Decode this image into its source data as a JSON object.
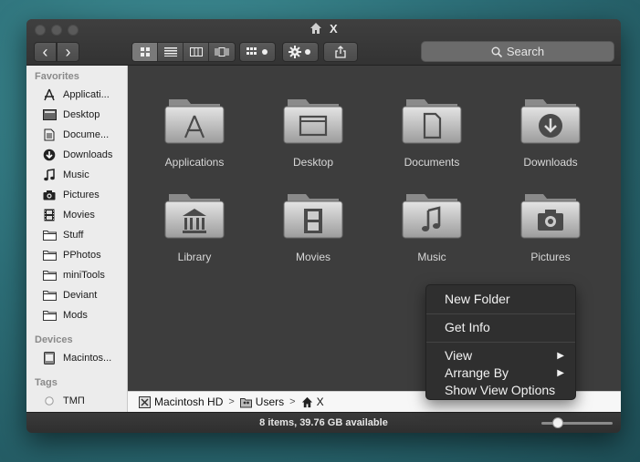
{
  "window": {
    "title": "X"
  },
  "toolbar": {
    "back_label": "‹",
    "forward_label": "›",
    "search_placeholder": "Search"
  },
  "sidebar": {
    "favorites_header": "Favorites",
    "favorites": [
      {
        "label": "Applicati...",
        "icon": "applications-icon"
      },
      {
        "label": "Desktop",
        "icon": "desktop-icon"
      },
      {
        "label": "Docume...",
        "icon": "documents-icon"
      },
      {
        "label": "Downloads",
        "icon": "downloads-icon"
      },
      {
        "label": "Music",
        "icon": "music-icon"
      },
      {
        "label": "Pictures",
        "icon": "camera-icon"
      },
      {
        "label": "Movies",
        "icon": "film-icon"
      },
      {
        "label": "Stuff",
        "icon": "folder-icon"
      },
      {
        "label": "PPhotos",
        "icon": "folder-icon"
      },
      {
        "label": "miniTools",
        "icon": "folder-icon"
      },
      {
        "label": "Deviant",
        "icon": "folder-icon"
      },
      {
        "label": "Mods",
        "icon": "folder-icon"
      }
    ],
    "devices_header": "Devices",
    "devices": [
      {
        "label": "Macintos...",
        "icon": "hard-drive-icon"
      }
    ],
    "tags_header": "Tags",
    "tags": [
      {
        "label": "ТМП",
        "icon": "tag-dot-icon"
      }
    ]
  },
  "content": {
    "items": [
      {
        "label": "Applications",
        "icon": "applications-folder-icon"
      },
      {
        "label": "Desktop",
        "icon": "desktop-folder-icon"
      },
      {
        "label": "Documents",
        "icon": "documents-folder-icon"
      },
      {
        "label": "Downloads",
        "icon": "downloads-folder-icon"
      },
      {
        "label": "Library",
        "icon": "library-folder-icon"
      },
      {
        "label": "Movies",
        "icon": "movies-folder-icon"
      },
      {
        "label": "Music",
        "icon": "music-folder-icon"
      },
      {
        "label": "Pictures",
        "icon": "pictures-folder-icon"
      }
    ]
  },
  "pathbar": {
    "crumbs": [
      "Macintosh HD",
      "Users",
      "X"
    ],
    "separator": ">"
  },
  "status": {
    "text": "8 items, 39.76 GB available"
  },
  "context_menu": {
    "items": [
      "New Folder",
      "Get Info",
      "View",
      "Arrange By",
      "Show View Options"
    ],
    "submenu_arrow": "▶"
  },
  "colors": {
    "window_bg": "#3a3a3a",
    "sidebar_bg": "#ececec",
    "menu_bg": "#2f2f2f"
  }
}
